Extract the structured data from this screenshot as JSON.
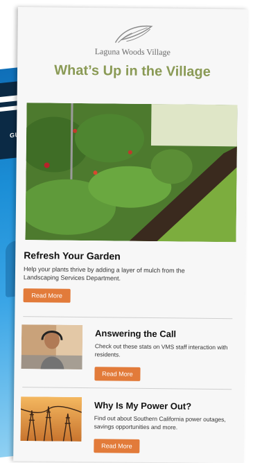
{
  "brand": {
    "name": "Laguna Woods Village"
  },
  "headline": "What’s Up in the Village",
  "background_magazine": {
    "fragment_text": "GUST"
  },
  "articles": [
    {
      "title": "Refresh Your Garden",
      "text": "Help your plants thrive by adding a layer of mulch from the Landscaping Services Department.",
      "button": "Read More"
    },
    {
      "title": "Answering the Call",
      "text": "Check out these stats on VMS staff interaction with residents.",
      "button": "Read More"
    },
    {
      "title": "Why Is My Power Out?",
      "text": "Find out about Southern California power outages, savings opportunities and more.",
      "button": "Read More"
    }
  ],
  "colors": {
    "accent": "#e27b3a",
    "headline": "#8a9a55",
    "card": "#f7f7f7"
  }
}
